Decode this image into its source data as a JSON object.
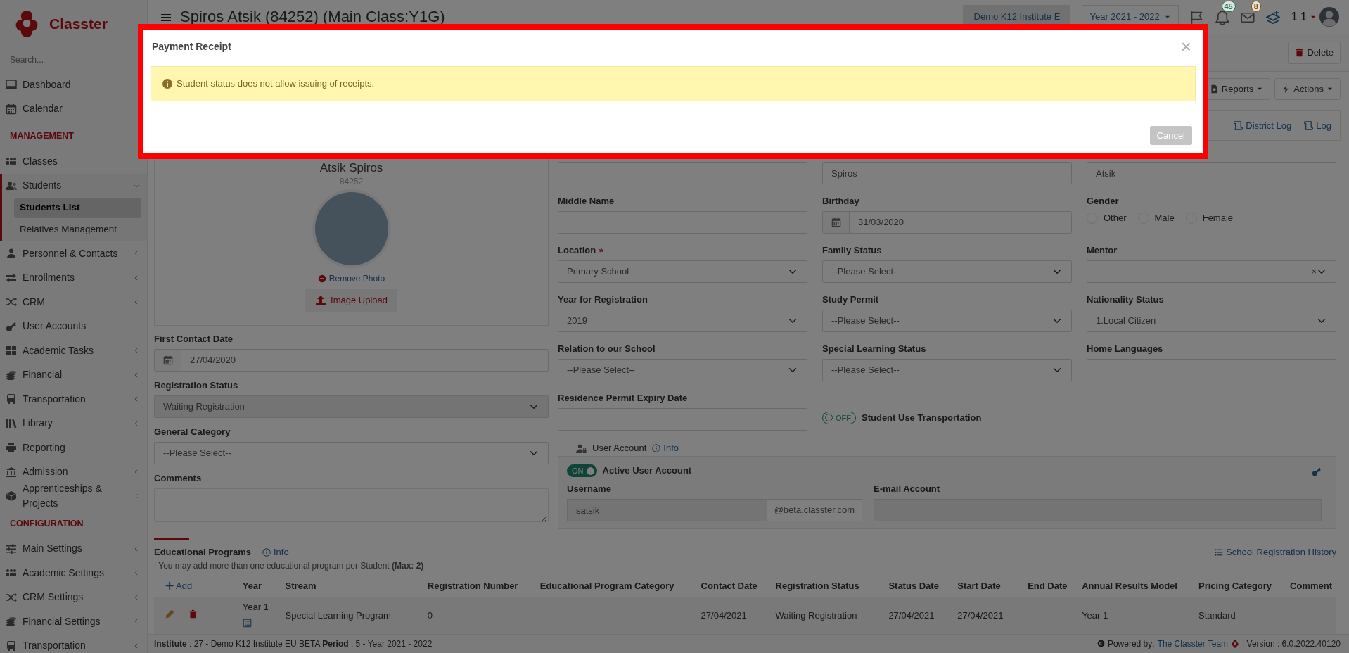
{
  "app": {
    "logo_text": "Classter",
    "search_placeholder": "Search..."
  },
  "sidebar": {
    "groups": [
      {
        "items": [
          {
            "label": "Dashboard",
            "submenu": false,
            "expanded": false,
            "selected": false
          },
          {
            "label": "Calendar",
            "submenu": false,
            "expanded": false,
            "selected": false
          }
        ]
      },
      {
        "title": "MANAGEMENT",
        "items": [
          {
            "label": "Classes",
            "submenu": false,
            "expanded": false,
            "selected": false
          },
          {
            "label": "Students",
            "submenu": true,
            "expanded": true,
            "selected": true,
            "children": [
              {
                "label": "Students List",
                "selected": true
              },
              {
                "label": "Relatives Management",
                "selected": false
              }
            ]
          },
          {
            "label": "Personnel & Contacts",
            "submenu": true,
            "expanded": false,
            "selected": false
          },
          {
            "label": "Enrollments",
            "submenu": true,
            "expanded": false,
            "selected": false
          },
          {
            "label": "CRM",
            "submenu": true,
            "expanded": false,
            "selected": false
          },
          {
            "label": "User Accounts",
            "submenu": false,
            "expanded": false,
            "selected": false
          },
          {
            "label": "Academic Tasks",
            "submenu": true,
            "expanded": false,
            "selected": false
          },
          {
            "label": "Financial",
            "submenu": true,
            "expanded": false,
            "selected": false
          },
          {
            "label": "Transportation",
            "submenu": true,
            "expanded": false,
            "selected": false
          },
          {
            "label": "Library",
            "submenu": true,
            "expanded": false,
            "selected": false
          },
          {
            "label": "Reporting",
            "submenu": false,
            "expanded": false,
            "selected": false
          },
          {
            "label": "Admission",
            "submenu": true,
            "expanded": false,
            "selected": false
          },
          {
            "label": "Apprenticeships & Projects",
            "submenu": true,
            "expanded": false,
            "selected": false
          }
        ]
      },
      {
        "title": "CONFIGURATION",
        "items": [
          {
            "label": "Main Settings",
            "submenu": true,
            "expanded": false,
            "selected": false
          },
          {
            "label": "Academic Settings",
            "submenu": true,
            "expanded": false,
            "selected": false
          },
          {
            "label": "CRM Settings",
            "submenu": true,
            "expanded": false,
            "selected": false
          },
          {
            "label": "Financial Settings",
            "submenu": true,
            "expanded": false,
            "selected": false
          },
          {
            "label": "Transportation",
            "submenu": true,
            "expanded": false,
            "selected": false
          }
        ]
      }
    ]
  },
  "header": {
    "title": "Spiros Atsik (84252) (Main Class:Y1G)",
    "institute": "Demo K12 Institute E",
    "year": "Year 2021 - 2022",
    "notifications": [
      {
        "kind": "bell",
        "count": "45",
        "color": "#137a4c"
      },
      {
        "kind": "envelope",
        "count": "8",
        "color": "#8f5208"
      }
    ],
    "user": "1 1"
  },
  "toolbar": {
    "delete": "Delete",
    "reports": "Reports",
    "actions": "Actions",
    "district_log": "District Log",
    "log": "Log"
  },
  "profile": {
    "name": "Atsik Spiros",
    "id": "84252",
    "remove_photo": "Remove Photo",
    "upload": "Image Upload"
  },
  "left_fields": [
    {
      "kind": "date",
      "label": "First Contact Date",
      "value": "27/04/2020",
      "disabled": false
    },
    {
      "kind": "select",
      "label": "Registration Status",
      "value": "Waiting Registration",
      "disabled": true
    },
    {
      "kind": "select",
      "label": "General Category",
      "value": "--Please Select--",
      "disabled": false
    },
    {
      "kind": "textarea",
      "label": "Comments",
      "disabled": false
    }
  ],
  "fields": [
    {
      "kind": "text",
      "required": false
    },
    {
      "kind": "text",
      "value": "Spiros",
      "required": false
    },
    {
      "kind": "text",
      "value": "Atsik",
      "required": false
    },
    {
      "kind": "text",
      "label": "Middle Name",
      "required": false
    },
    {
      "kind": "date",
      "label": "Birthday",
      "value": "31/03/2020",
      "required": false
    },
    {
      "kind": "radios",
      "label": "Gender",
      "required": false,
      "options": [
        {
          "label": "Other",
          "checked": false
        },
        {
          "label": "Male",
          "checked": false
        },
        {
          "label": "Female",
          "checked": false
        }
      ]
    },
    {
      "kind": "select",
      "label": "Location",
      "value": "Primary School",
      "required": true
    },
    {
      "kind": "select",
      "label": "Family Status",
      "value": "--Please Select--",
      "required": false
    },
    {
      "kind": "select",
      "label": "Mentor",
      "clear": "×",
      "required": false
    },
    {
      "kind": "select",
      "label": "Year for Registration",
      "value": "2019",
      "required": false
    },
    {
      "kind": "select",
      "label": "Study Permit",
      "value": "--Please Select--",
      "required": false
    },
    {
      "kind": "select",
      "label": "Nationality Status",
      "value": "1.Local Citizen",
      "required": false
    },
    {
      "kind": "select",
      "label": "Relation to our School",
      "value": "--Please Select--",
      "required": false
    },
    {
      "kind": "select",
      "label": "Special Learning Status",
      "value": "--Please Select--",
      "required": false
    },
    {
      "kind": "text",
      "label": "Home Languages",
      "required": false
    },
    {
      "kind": "text",
      "label": "Residence Permit Expiry Date",
      "required": false
    },
    {
      "kind": "toggle",
      "label": "Student Use Transportation",
      "on": false,
      "state_text": "OFF",
      "required": false
    }
  ],
  "user_account": {
    "title": "User Account",
    "info": "Info",
    "toggle": {
      "label": "Active User Account",
      "on": true,
      "state_text": "ON"
    },
    "username_label": "Username",
    "username": "satsik",
    "domain": "@beta.classter.com",
    "email_label": "E-mail Account"
  },
  "educational_programs": {
    "title": "Educational Programs",
    "info": "Info",
    "note": "| You may add more than one educational program per Student **(Max: 2)**",
    "history": "School Registration History",
    "add": "Add",
    "columns": [
      "Year",
      "Stream",
      "Registration Number",
      "Educational Program Category",
      "Contact Date",
      "Registration Status",
      "Status Date",
      "Start Date",
      "End Date",
      "Annual Results Model",
      "Pricing Category",
      "Comment"
    ],
    "rows": [
      {
        "year": "Year 1",
        "stream": "Special Learning Program",
        "registration_number": "0",
        "contact_date": "27/04/2021",
        "registration_status": "Waiting Registration",
        "status_date": "27/04/2021",
        "start_date": "27/04/2021",
        "annual_results_model": "Year 1",
        "pricing_category": "Standard"
      }
    ]
  },
  "footer": {
    "info": "**Institute** : 27 - Demo K12 Institute EU BETA **Period** : 5 - Year 2021 - 2022",
    "powered": "Powered by:",
    "team": "The Classter Team",
    "version": "| Version : 6.0.2022.40120"
  },
  "modal": {
    "title": "Payment Receipt",
    "close": "×",
    "message": "Student status does not allow issuing of receipts.",
    "cancel": "Cancel"
  }
}
